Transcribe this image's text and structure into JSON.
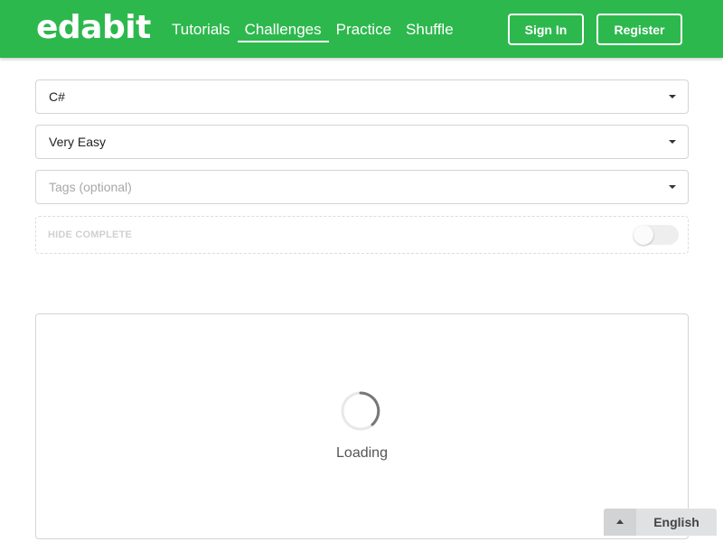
{
  "header": {
    "logo": "edabit",
    "nav": [
      {
        "label": "Tutorials",
        "active": false
      },
      {
        "label": "Challenges",
        "active": true
      },
      {
        "label": "Practice",
        "active": false
      },
      {
        "label": "Shuffle",
        "active": false
      }
    ],
    "sign_in_label": "Sign In",
    "register_label": "Register",
    "background_color": "#2db84d"
  },
  "filters": {
    "language": {
      "value": "C#",
      "icon": "caret-down-icon"
    },
    "difficulty": {
      "value": "Very Easy",
      "icon": "caret-down-icon"
    },
    "tags": {
      "placeholder": "Tags (optional)",
      "value": "",
      "icon": "caret-down-icon"
    },
    "hide_complete": {
      "label": "HIDE COMPLETE",
      "enabled": false
    }
  },
  "results": {
    "status_text": "Loading",
    "spinner_icon": "loading-spinner-icon"
  },
  "language_selector": {
    "label": "English",
    "icon": "caret-up-icon"
  }
}
